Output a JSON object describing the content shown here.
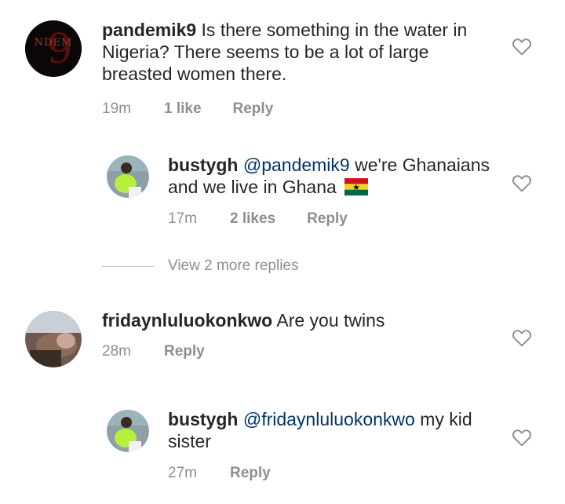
{
  "comments": [
    {
      "username": "pandemik9",
      "text": "Is there something in the water in Nigeria? There seems to be a lot of large breasted women there.",
      "time": "19m",
      "likes": "1 like",
      "reply": "Reply",
      "avatar_text": "NDEM"
    },
    {
      "username": "bustygh",
      "mention": "@pandemik9",
      "text": "we're Ghanaians and we live in Ghana",
      "time": "17m",
      "likes": "2 likes",
      "reply": "Reply"
    },
    {
      "username": "fridaynluluokonkwo",
      "text": "Are you twins",
      "time": "28m",
      "reply": "Reply"
    },
    {
      "username": "bustygh",
      "mention": "@fridaynluluokonkwo",
      "text": "my kid sister",
      "time": "27m",
      "reply": "Reply"
    }
  ],
  "view_more": "View 2 more replies",
  "colors": {
    "text": "#262626",
    "meta": "#8e8e8e",
    "mention": "#003569",
    "heart": "#8e8e8e"
  },
  "icons": {
    "like": "heart-outline-icon",
    "flag": "ghana-flag-emoji"
  }
}
